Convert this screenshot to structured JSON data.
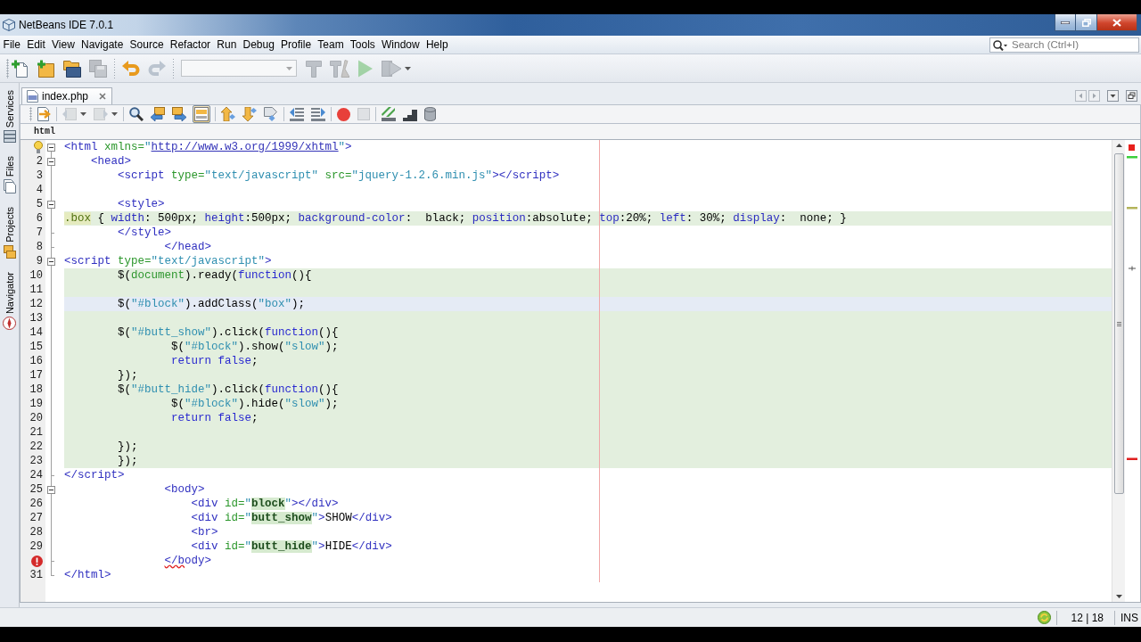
{
  "window": {
    "title": "NetBeans IDE 7.0.1"
  },
  "menu": [
    "File",
    "Edit",
    "View",
    "Navigate",
    "Source",
    "Refactor",
    "Run",
    "Debug",
    "Profile",
    "Team",
    "Tools",
    "Window",
    "Help"
  ],
  "search": {
    "placeholder": "Search (Ctrl+I)"
  },
  "toolbar": {
    "groups": [
      [
        {
          "kind": "newfile",
          "disabled": false
        },
        {
          "kind": "newproject",
          "disabled": false
        },
        {
          "kind": "openproject",
          "disabled": false
        },
        {
          "kind": "saveall",
          "disabled": true
        }
      ],
      [
        {
          "kind": "undo",
          "disabled": false
        },
        {
          "kind": "redo",
          "disabled": true
        }
      ],
      [
        {
          "kind": "combo",
          "disabled": true
        },
        {
          "kind": "build",
          "disabled": true
        },
        {
          "kind": "clean",
          "disabled": true
        },
        {
          "kind": "run",
          "disabled": true
        },
        {
          "kind": "debug",
          "disabled": true,
          "dropdown": true
        }
      ]
    ]
  },
  "side_tabs": [
    {
      "label": "Services"
    },
    {
      "label": "Files"
    },
    {
      "label": "Projects"
    },
    {
      "label": "Navigator"
    }
  ],
  "editor": {
    "tabs": [
      {
        "label": "index.php",
        "selected": true
      }
    ],
    "toolbar": {
      "groups": [
        [
          {
            "kind": "history",
            "disabled": false,
            "on": false
          }
        ],
        [
          {
            "kind": "back",
            "disabled": true,
            "on": false,
            "dropdown": true
          },
          {
            "kind": "forward",
            "disabled": true,
            "on": false,
            "dropdown": true
          }
        ],
        [
          {
            "kind": "find",
            "disabled": false,
            "on": false
          },
          {
            "kind": "findprev",
            "disabled": false,
            "on": false
          },
          {
            "kind": "findnext",
            "disabled": false,
            "on": false
          },
          {
            "kind": "highlight",
            "disabled": false,
            "on": true
          }
        ],
        [
          {
            "kind": "prevmark",
            "disabled": false,
            "on": false
          },
          {
            "kind": "nextmark",
            "disabled": false,
            "on": false
          },
          {
            "kind": "togglemark",
            "disabled": false,
            "on": false
          }
        ],
        [
          {
            "kind": "shiftleft",
            "disabled": false,
            "on": false
          },
          {
            "kind": "shiftright",
            "disabled": false,
            "on": false
          }
        ],
        [
          {
            "kind": "record",
            "disabled": false,
            "on": false
          },
          {
            "kind": "stop",
            "disabled": true,
            "on": false
          }
        ],
        [
          {
            "kind": "stripes",
            "disabled": false,
            "on": false
          },
          {
            "kind": "steps",
            "disabled": false,
            "on": false
          },
          {
            "kind": "cylinder",
            "disabled": false,
            "on": false
          }
        ]
      ]
    },
    "breadcrumb": "html",
    "lines": [
      {
        "kind": "plain",
        "marker": {
          "kind": "hint"
        },
        "fold": {
          "kind": "start"
        },
        "tokens": [
          {
            "kind": "tag",
            "text": "<html"
          },
          {
            "kind": "attr",
            "text": " xmlns="
          },
          {
            "kind": "value",
            "text": "\""
          },
          {
            "kind": "link",
            "text": "http://www.w3.org/1999/xhtml"
          },
          {
            "kind": "value",
            "text": "\""
          },
          {
            "kind": "tag",
            "text": ">"
          }
        ]
      },
      {
        "kind": "plain",
        "number": "2",
        "fold": {
          "kind": "start"
        },
        "tokens": [
          {
            "kind": "tag",
            "text": "    <head>"
          }
        ]
      },
      {
        "kind": "plain",
        "number": "3",
        "tokens": [
          {
            "kind": "tag",
            "text": "        <script"
          },
          {
            "kind": "attr",
            "text": " type="
          },
          {
            "kind": "value",
            "text": "\"text/javascript\""
          },
          {
            "kind": "attr",
            "text": " src="
          },
          {
            "kind": "value",
            "text": "\"jquery-1.2.6.min.js\""
          },
          {
            "kind": "tag",
            "text": "></script>"
          }
        ]
      },
      {
        "kind": "plain",
        "number": "4"
      },
      {
        "kind": "plain",
        "number": "5",
        "fold": {
          "kind": "start"
        },
        "tokens": [
          {
            "kind": "tag",
            "text": "        <style>"
          }
        ]
      },
      {
        "kind": "embedded",
        "number": "6",
        "tokens": [
          {
            "kind": "selector",
            "text": ".box"
          },
          {
            "kind": "plain",
            "text": " { "
          },
          {
            "kind": "prop",
            "text": "width"
          },
          {
            "kind": "plain",
            "text": ": 500px; "
          },
          {
            "kind": "prop",
            "text": "height"
          },
          {
            "kind": "plain",
            "text": ":500px; "
          },
          {
            "kind": "prop",
            "text": "background-color"
          },
          {
            "kind": "plain",
            "text": ":  black; "
          },
          {
            "kind": "prop",
            "text": "position"
          },
          {
            "kind": "plain",
            "text": ":absolute; "
          },
          {
            "kind": "prop",
            "text": "top"
          },
          {
            "kind": "plain",
            "text": ":20%; "
          },
          {
            "kind": "prop",
            "text": "left"
          },
          {
            "kind": "plain",
            "text": ": 30%; "
          },
          {
            "kind": "prop",
            "text": "display"
          },
          {
            "kind": "plain",
            "text": ":  none; }"
          }
        ]
      },
      {
        "kind": "plain",
        "number": "7",
        "fold": {
          "kind": "end"
        },
        "tokens": [
          {
            "kind": "tag",
            "text": "        </style>"
          }
        ]
      },
      {
        "kind": "plain",
        "number": "8",
        "fold": {
          "kind": "end"
        },
        "tokens": [
          {
            "kind": "tag",
            "text": "               </head>"
          }
        ]
      },
      {
        "kind": "plain",
        "number": "9",
        "fold": {
          "kind": "start"
        },
        "tokens": [
          {
            "kind": "tag",
            "text": "<script"
          },
          {
            "kind": "attr",
            "text": " type="
          },
          {
            "kind": "value",
            "text": "\"text/javascript\""
          },
          {
            "kind": "tag",
            "text": ">"
          }
        ]
      },
      {
        "kind": "embedded",
        "number": "10",
        "tokens": [
          {
            "kind": "plain",
            "text": "        $("
          },
          {
            "kind": "ident",
            "text": "document"
          },
          {
            "kind": "plain",
            "text": ").ready("
          },
          {
            "kind": "keyword",
            "text": "function"
          },
          {
            "kind": "plain",
            "text": "(){"
          }
        ]
      },
      {
        "kind": "embedded",
        "number": "11"
      },
      {
        "kind": "current",
        "number": "12",
        "tokens": [
          {
            "kind": "plain",
            "text": "        $("
          },
          {
            "kind": "string",
            "text": "\"#block\""
          },
          {
            "kind": "plain",
            "text": ").addClass("
          },
          {
            "kind": "string",
            "text": "\"box\""
          },
          {
            "kind": "plain",
            "text": ");"
          }
        ]
      },
      {
        "kind": "embedded",
        "number": "13"
      },
      {
        "kind": "embedded",
        "number": "14",
        "tokens": [
          {
            "kind": "plain",
            "text": "        $("
          },
          {
            "kind": "string",
            "text": "\"#butt_show\""
          },
          {
            "kind": "plain",
            "text": ").click("
          },
          {
            "kind": "keyword",
            "text": "function"
          },
          {
            "kind": "plain",
            "text": "(){"
          }
        ]
      },
      {
        "kind": "embedded",
        "number": "15",
        "tokens": [
          {
            "kind": "plain",
            "text": "                $("
          },
          {
            "kind": "string",
            "text": "\"#block\""
          },
          {
            "kind": "plain",
            "text": ").show("
          },
          {
            "kind": "string",
            "text": "\"slow\""
          },
          {
            "kind": "plain",
            "text": ");"
          }
        ]
      },
      {
        "kind": "embedded",
        "number": "16",
        "tokens": [
          {
            "kind": "keyword",
            "text": "                return false"
          },
          {
            "kind": "plain",
            "text": ";"
          }
        ]
      },
      {
        "kind": "embedded",
        "number": "17",
        "tokens": [
          {
            "kind": "plain",
            "text": "        });"
          }
        ]
      },
      {
        "kind": "embedded",
        "number": "18",
        "tokens": [
          {
            "kind": "plain",
            "text": "        $("
          },
          {
            "kind": "string",
            "text": "\"#butt_hide\""
          },
          {
            "kind": "plain",
            "text": ").click("
          },
          {
            "kind": "keyword",
            "text": "function"
          },
          {
            "kind": "plain",
            "text": "(){"
          }
        ]
      },
      {
        "kind": "embedded",
        "number": "19",
        "tokens": [
          {
            "kind": "plain",
            "text": "                $("
          },
          {
            "kind": "string",
            "text": "\"#block\""
          },
          {
            "kind": "plain",
            "text": ").hide("
          },
          {
            "kind": "string",
            "text": "\"slow\""
          },
          {
            "kind": "plain",
            "text": ");"
          }
        ]
      },
      {
        "kind": "embedded",
        "number": "20",
        "tokens": [
          {
            "kind": "keyword",
            "text": "                return false"
          },
          {
            "kind": "plain",
            "text": ";"
          }
        ]
      },
      {
        "kind": "embedded",
        "number": "21"
      },
      {
        "kind": "embedded",
        "number": "22",
        "tokens": [
          {
            "kind": "plain",
            "text": "        });"
          }
        ]
      },
      {
        "kind": "embedded",
        "number": "23",
        "tokens": [
          {
            "kind": "plain",
            "text": "        });"
          }
        ]
      },
      {
        "kind": "plain",
        "number": "24",
        "fold": {
          "kind": "end"
        },
        "tokens": [
          {
            "kind": "tag",
            "text": "</script>"
          }
        ]
      },
      {
        "kind": "plain",
        "number": "25",
        "fold": {
          "kind": "start"
        },
        "tokens": [
          {
            "kind": "tag",
            "text": "               <body>"
          }
        ]
      },
      {
        "kind": "plain",
        "number": "26",
        "tokens": [
          {
            "kind": "tag",
            "text": "                   <div"
          },
          {
            "kind": "attr",
            "text": " id="
          },
          {
            "kind": "value",
            "text": "\""
          },
          {
            "kind": "marked",
            "text": "block"
          },
          {
            "kind": "value",
            "text": "\""
          },
          {
            "kind": "tag",
            "text": "></div>"
          }
        ]
      },
      {
        "kind": "plain",
        "number": "27",
        "tokens": [
          {
            "kind": "tag",
            "text": "                   <div"
          },
          {
            "kind": "attr",
            "text": " id="
          },
          {
            "kind": "value",
            "text": "\""
          },
          {
            "kind": "marked",
            "text": "butt_show"
          },
          {
            "kind": "value",
            "text": "\""
          },
          {
            "kind": "tag",
            "text": ">"
          },
          {
            "kind": "plain",
            "text": "SHOW"
          },
          {
            "kind": "tag",
            "text": "</div>"
          }
        ]
      },
      {
        "kind": "plain",
        "number": "28",
        "tokens": [
          {
            "kind": "tag",
            "text": "                   <br>"
          }
        ]
      },
      {
        "kind": "plain",
        "number": "29",
        "tokens": [
          {
            "kind": "tag",
            "text": "                   <div"
          },
          {
            "kind": "attr",
            "text": " id="
          },
          {
            "kind": "value",
            "text": "\""
          },
          {
            "kind": "marked",
            "text": "butt_hide"
          },
          {
            "kind": "value",
            "text": "\""
          },
          {
            "kind": "tag",
            "text": ">"
          },
          {
            "kind": "plain",
            "text": "HIDE"
          },
          {
            "kind": "tag",
            "text": "</div>"
          }
        ]
      },
      {
        "kind": "plain",
        "marker": {
          "kind": "error"
        },
        "fold": {
          "kind": "end"
        },
        "tokens": [
          {
            "kind": "error",
            "text": "               </b"
          },
          {
            "kind": "tag",
            "text": "ody>"
          }
        ]
      },
      {
        "kind": "plain",
        "number": "31",
        "fold": {
          "kind": "end"
        },
        "tokens": [
          {
            "kind": "tag",
            "text": "</html>"
          }
        ]
      }
    ]
  },
  "status_bar": {
    "position": "12 | 18",
    "mode": "INS"
  }
}
